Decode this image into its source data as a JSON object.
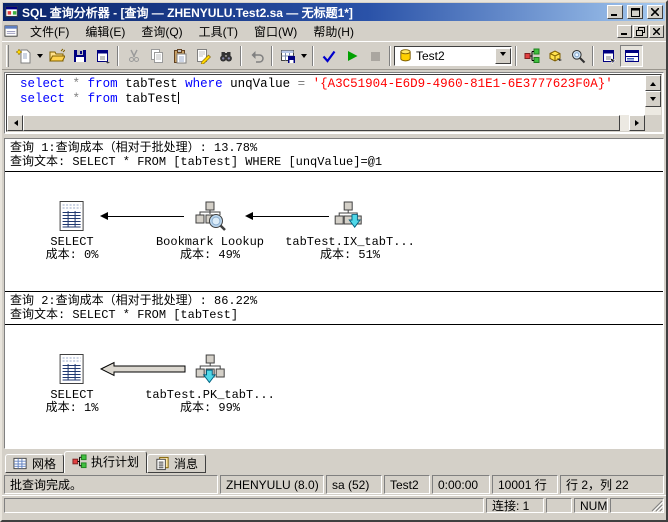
{
  "window": {
    "title": "SQL 查询分析器 - [查询 — ZHENYULU.Test2.sa — 无标题1*]",
    "controls": [
      "minimize",
      "maximize",
      "close"
    ],
    "mdi_controls": [
      "minimize",
      "restore",
      "close"
    ]
  },
  "menu": {
    "items": [
      "文件(F)",
      "编辑(E)",
      "查询(Q)",
      "工具(T)",
      "窗口(W)",
      "帮助(H)"
    ]
  },
  "toolbar": {
    "database_value": "Test2",
    "icons": [
      "new-query",
      "open-file",
      "save",
      "insert-template",
      "cut",
      "copy",
      "paste",
      "clear-window",
      "find",
      "undo",
      "execute-mode",
      "parse-query",
      "execute-query",
      "cancel-query",
      "database",
      "execution-plan",
      "object-browser",
      "object-search",
      "connection-properties",
      "show-results-pane"
    ]
  },
  "editor": {
    "lines": [
      [
        {
          "t": "select",
          "c": "kw"
        },
        {
          "t": " ",
          "c": "pl"
        },
        {
          "t": "*",
          "c": "op"
        },
        {
          "t": " ",
          "c": "pl"
        },
        {
          "t": "from",
          "c": "kw"
        },
        {
          "t": " tabTest ",
          "c": "pl"
        },
        {
          "t": "where",
          "c": "kw"
        },
        {
          "t": " unqValue ",
          "c": "pl"
        },
        {
          "t": "=",
          "c": "op"
        },
        {
          "t": " ",
          "c": "pl"
        },
        {
          "t": "'{A3C51904-E6D9-4960-81E1-6E3777623F0A}'",
          "c": "str"
        }
      ],
      [
        {
          "t": "select",
          "c": "kw"
        },
        {
          "t": " ",
          "c": "pl"
        },
        {
          "t": "*",
          "c": "op"
        },
        {
          "t": " ",
          "c": "pl"
        },
        {
          "t": "from",
          "c": "kw"
        },
        {
          "t": " tabTest",
          "c": "pl"
        }
      ]
    ]
  },
  "plan": {
    "sections": [
      {
        "header1": "查询 1:查询成本（相对于批处理）: 13.78%",
        "header2": "查询文本: SELECT * FROM [tabTest] WHERE [unqValue]=@1",
        "nodes": [
          {
            "label": "SELECT",
            "cost": "成本: 0%"
          },
          {
            "label": "Bookmark Lookup",
            "cost": "成本: 49%"
          },
          {
            "label": "tabTest.IX_tabT...",
            "cost": "成本: 51%"
          }
        ]
      },
      {
        "header1": "查询 2:查询成本（相对于批处理）: 86.22%",
        "header2": "查询文本: SELECT * FROM [tabTest]",
        "nodes": [
          {
            "label": "SELECT",
            "cost": "成本: 1%"
          },
          {
            "label": "tabTest.PK_tabT...",
            "cost": "成本: 99%"
          }
        ]
      }
    ]
  },
  "tabs": [
    {
      "label": "网格",
      "active": false
    },
    {
      "label": "执行计划",
      "active": true
    },
    {
      "label": "消息",
      "active": false
    }
  ],
  "query_status": {
    "message": "批查询完成。",
    "server": "ZHENYULU (8.0)",
    "user": "sa (52)",
    "database": "Test2",
    "time": "0:00:00",
    "rows": "10001 行",
    "position": "行 2，列 22"
  },
  "app_status": {
    "connections": "连接: 1",
    "num_lock": "NUM"
  },
  "colors": {
    "title_gradient_start": "#0A246A",
    "title_gradient_end": "#A6CAF0",
    "chrome": "#D4D0C8",
    "keyword": "#0000FF",
    "string": "#FF0000",
    "operator": "#808080",
    "execute_green": "#00A000",
    "parse_blue": "#0000CC"
  }
}
